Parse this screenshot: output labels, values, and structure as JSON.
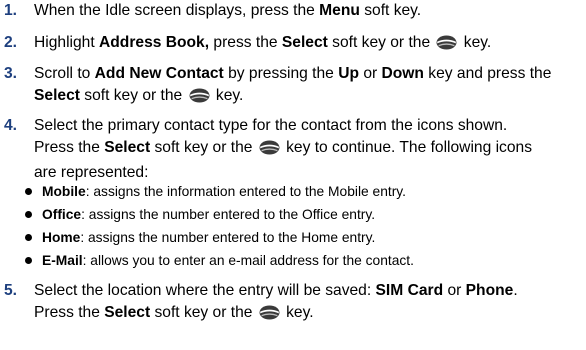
{
  "steps": [
    {
      "num": "1.",
      "lines": [
        [
          "When the Idle screen displays, press the ",
          {
            "b": "Menu"
          },
          " soft key."
        ]
      ]
    },
    {
      "num": "2.",
      "lines": [
        [
          "Highlight ",
          {
            "b": "Address Book,"
          },
          " press the ",
          {
            "b": "Select"
          },
          " soft key or the ",
          {
            "icon": "ok-key-icon"
          },
          " key."
        ]
      ]
    },
    {
      "num": "3.",
      "lines": [
        [
          "Scroll to ",
          {
            "b": "Add New Contact"
          },
          " by pressing the ",
          {
            "b": "Up"
          },
          " or ",
          {
            "b": "Down"
          },
          " key and press the"
        ],
        [
          {
            "b": "Select"
          },
          " soft key or the ",
          {
            "icon": "ok-key-icon"
          },
          " key."
        ]
      ]
    },
    {
      "num": "4.",
      "lines": [
        [
          "Select the primary contact type for the contact from the icons shown."
        ],
        [
          "Press the ",
          {
            "b": "Select"
          },
          " soft key or the ",
          {
            "icon": "ok-key-icon"
          },
          " key to continue. The following icons"
        ],
        [
          "are represented:"
        ]
      ]
    },
    {
      "num": "5.",
      "lines": [
        [
          "Select the location where the entry will be saved: ",
          {
            "b": "SIM Card"
          },
          " or ",
          {
            "b": "Phone"
          },
          "."
        ],
        [
          "Press the ",
          {
            "b": "Select"
          },
          " soft key or the ",
          {
            "icon": "ok-key-icon"
          },
          " key."
        ]
      ]
    }
  ],
  "bullets": [
    {
      "term": "Mobile",
      "text": ": assigns the information entered to the Mobile entry."
    },
    {
      "term": "Office",
      "text": ": assigns the number entered to the Office entry."
    },
    {
      "term": "Home",
      "text": ": assigns the number entered to the Home entry."
    },
    {
      "term": "E-Mail",
      "text": ": allows you to enter an e-mail address for the contact."
    }
  ],
  "colors": {
    "step_number": "#1d3f7e",
    "text": "#000000"
  }
}
